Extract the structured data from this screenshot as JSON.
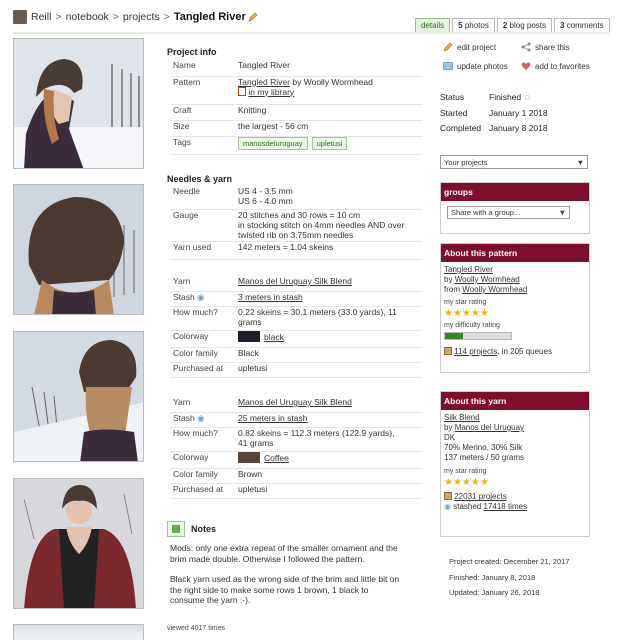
{
  "breadcrumb": {
    "user": "Reill",
    "notebook": "notebook",
    "projects": "projects",
    "current": "Tangled River",
    "sep": ">"
  },
  "tabs": [
    {
      "label": "details",
      "count": ""
    },
    {
      "label": "photos",
      "count": "5"
    },
    {
      "label": "blog posts",
      "count": "2"
    },
    {
      "label": "comments",
      "count": "3"
    }
  ],
  "project_info": {
    "heading": "Project info",
    "name_label": "Name",
    "name": "Tangled River",
    "pattern_label": "Pattern",
    "pattern": "Tangled River",
    "pattern_by": "by",
    "pattern_designer": "Woolly Wormhead",
    "library": "in my library",
    "craft_label": "Craft",
    "craft": "Knitting",
    "size_label": "Size",
    "size": "the largest - 56 cm",
    "tags_label": "Tags",
    "tags": [
      "manosdeluruguay",
      "upletusi"
    ]
  },
  "needles": {
    "heading": "Needles & yarn",
    "needle_label": "Needle",
    "needle1": "US 4  - 3.5 mm",
    "needle2": "US 6  - 4.0 mm",
    "gauge_label": "Gauge",
    "gauge1": "20 stitches and 30 rows = 10 cm",
    "gauge2": "in stocking stitch on 4mm needles AND over",
    "gauge3": "twisted rib on 3.75mm needles",
    "yarn_used_label": "Yarn used",
    "yarn_used": "142 meters = 1.04 skeins"
  },
  "yarns": [
    {
      "yarn_label": "Yarn",
      "yarn": "Manos del Uruguay Silk Blend",
      "stash_label": "Stash",
      "stash": "3 meters in stash",
      "how_label": "How much?",
      "how1": "0.22 skeins = 30.1 meters (33.0 yards), 11",
      "how2": "grams",
      "colorway_label": "Colorway",
      "colorway": "black",
      "family_label": "Color family",
      "family": "Black",
      "purchased_label": "Purchased at",
      "purchased": "upletusi",
      "swatch": "#1f2128"
    },
    {
      "yarn_label": "Yarn",
      "yarn": "Manos del Uruguay Silk Blend",
      "stash_label": "Stash",
      "stash": "25 meters in stash",
      "how_label": "How much?",
      "how1": "0.82 skeins = 112.3 meters (122.9 yards),",
      "how2": "41 grams",
      "colorway_label": "Colorway",
      "colorway": "Coffee",
      "family_label": "Color family",
      "family": "Brown",
      "purchased_label": "Purchased at",
      "purchased": "upletusi",
      "swatch": "#5a4437"
    }
  ],
  "notes": {
    "heading": "Notes",
    "p1a": "Mods: only one extra repeat of the smaller ornament and the",
    "p1b": "brim made double. Otherwise I followed the pattern.",
    "p2a": "Black yarn used as the wrong side of the brim and little bit on",
    "p2b": "the right side to make some rows 1 brown, 1 black to",
    "p2c": "consume the yarn :-).",
    "views": "viewed 4017 times"
  },
  "actions": {
    "edit": "edit project",
    "share": "share this",
    "update_photos": "update photos",
    "favorites": "add to favorites"
  },
  "status": {
    "status_label": "Status",
    "status": "Finished",
    "started_label": "Started",
    "started": "January 1 2018",
    "completed_label": "Completed",
    "completed": "January 8 2018"
  },
  "your_projects": "Your projects",
  "groups": {
    "heading": "groups",
    "share": "Share with a group..."
  },
  "about_pattern": {
    "heading": "About this pattern",
    "name": "Tangled River",
    "by": "by",
    "designer": "Woolly Wormhead",
    "from": "from",
    "source": "Woolly Wormhead",
    "star_label": "my star rating",
    "diff_label": "my difficulty rating",
    "difficulty": 0.28,
    "projects": "114 projects",
    "queues": ", in 205 queues"
  },
  "about_yarn": {
    "heading": "About this yarn",
    "name": "Silk Blend",
    "by": "by",
    "maker": "Manos del Uruguay",
    "weight": "DK",
    "fiber": "70% Merino, 30% Silk",
    "put_up": "137 meters / 50 grams",
    "star_label": "my star rating",
    "projects": "22031 projects",
    "stashed_pre": "stashed",
    "stashed": "17418 times"
  },
  "meta": {
    "created": "Project created: December 21, 2017",
    "finished": "Finished: January 8, 2018",
    "updated": "Updated: January 26, 2018"
  },
  "colors": {
    "accent": "#7e0d2e",
    "green": "#2a6e1a",
    "star": "#f0b400"
  }
}
